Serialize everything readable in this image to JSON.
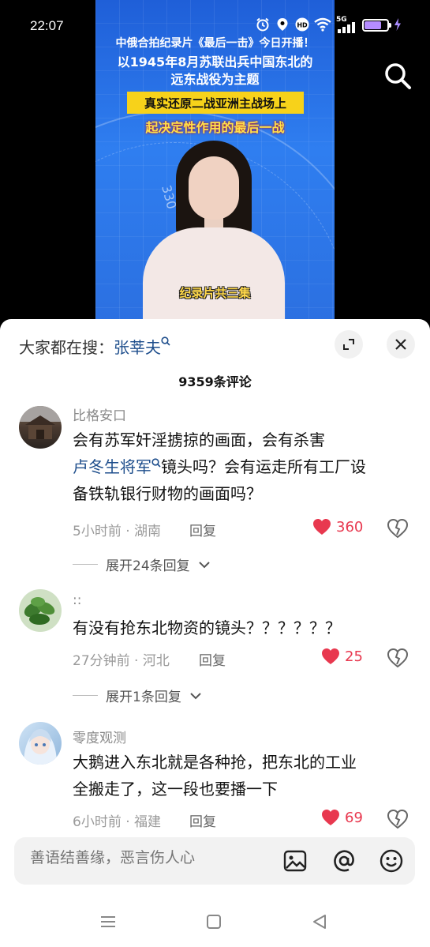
{
  "status_bar": {
    "time": "22:07",
    "network": "5G",
    "icons": [
      "alarm-icon",
      "location-icon",
      "hd-icon",
      "wifi-icon",
      "signal-icon",
      "battery-icon",
      "charging-icon"
    ],
    "battery_level": 0.75
  },
  "video": {
    "caption_line1": "中俄合拍纪录片《最后一击》今日开播！",
    "caption_line2a": "以1945年8月苏联出兵中国东北的",
    "caption_line2b": "远东战役为主题",
    "caption_line3": "真实还原二战亚洲主战场上",
    "caption_line4": "起决定性作用的最后一战",
    "dial_number": "330",
    "subtitle": "纪录片共三集",
    "search_icon": "search-icon"
  },
  "panel": {
    "search_label": "大家都在搜：",
    "search_keyword": "张莘夫",
    "comment_count": "9359条评论",
    "icons": {
      "expand": "expand-icon",
      "close": "close-icon"
    }
  },
  "comments": [
    {
      "user": "比格安口",
      "text_part1": "会有苏军奸淫掳掠的画面，会有杀害",
      "link": "卢冬生将军",
      "text_part2": "镜头吗？会有运走所有工厂设",
      "text_part3": "备铁轨银行财物的画面吗？",
      "meta": "5小时前 · 湖南",
      "reply": "回复",
      "likes": "360",
      "expand": "展开24条回复"
    },
    {
      "user": "::",
      "text": "有没有抢东北物资的镜头？？？？？？",
      "meta": "27分钟前 · 河北",
      "reply": "回复",
      "likes": "25",
      "expand": "展开1条回复"
    },
    {
      "user": "零度观测",
      "text_line1": "大鹅进入东北就是各种抢，把东北的工业",
      "text_line2": "全搬走了，这一段也要播一下",
      "meta": "6小时前 · 福建",
      "reply": "回复",
      "likes": "69"
    }
  ],
  "input_bar": {
    "placeholder": "善语结善缘，恶言伤人心",
    "icons": [
      "image-icon",
      "mention-icon",
      "emoji-icon"
    ]
  },
  "nav_bar": {
    "icons": [
      "menu-icon",
      "home-icon",
      "back-icon"
    ]
  },
  "colors": {
    "like_red": "#e8384f",
    "link_blue": "#1e4e8c",
    "video_blue": "#2f7ef0",
    "caption_yellow": "#f7d21a"
  }
}
